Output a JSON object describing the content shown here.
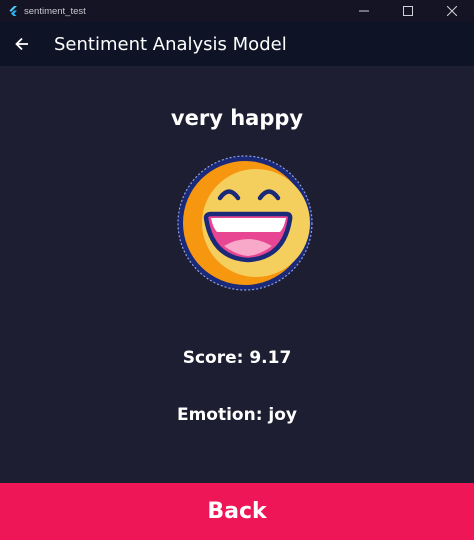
{
  "window": {
    "title": "sentiment_test"
  },
  "appbar": {
    "title": "Sentiment Analysis Model",
    "back_icon": "arrow-left-icon"
  },
  "result": {
    "label": "very happy",
    "score_text": "Score: 9.17",
    "emotion_text": "Emotion: joy",
    "emoji_icon": "laughing-face-icon"
  },
  "footer": {
    "back_label": "Back"
  },
  "colors": {
    "background": "#1e1e33",
    "appbar": "#0f1326",
    "accent_button": "#ee1657",
    "emoji_face": "#f5cf5e",
    "emoji_shade": "#f7960f",
    "emoji_mouth": "#e84593",
    "emoji_tongue": "#f8a8c8"
  }
}
